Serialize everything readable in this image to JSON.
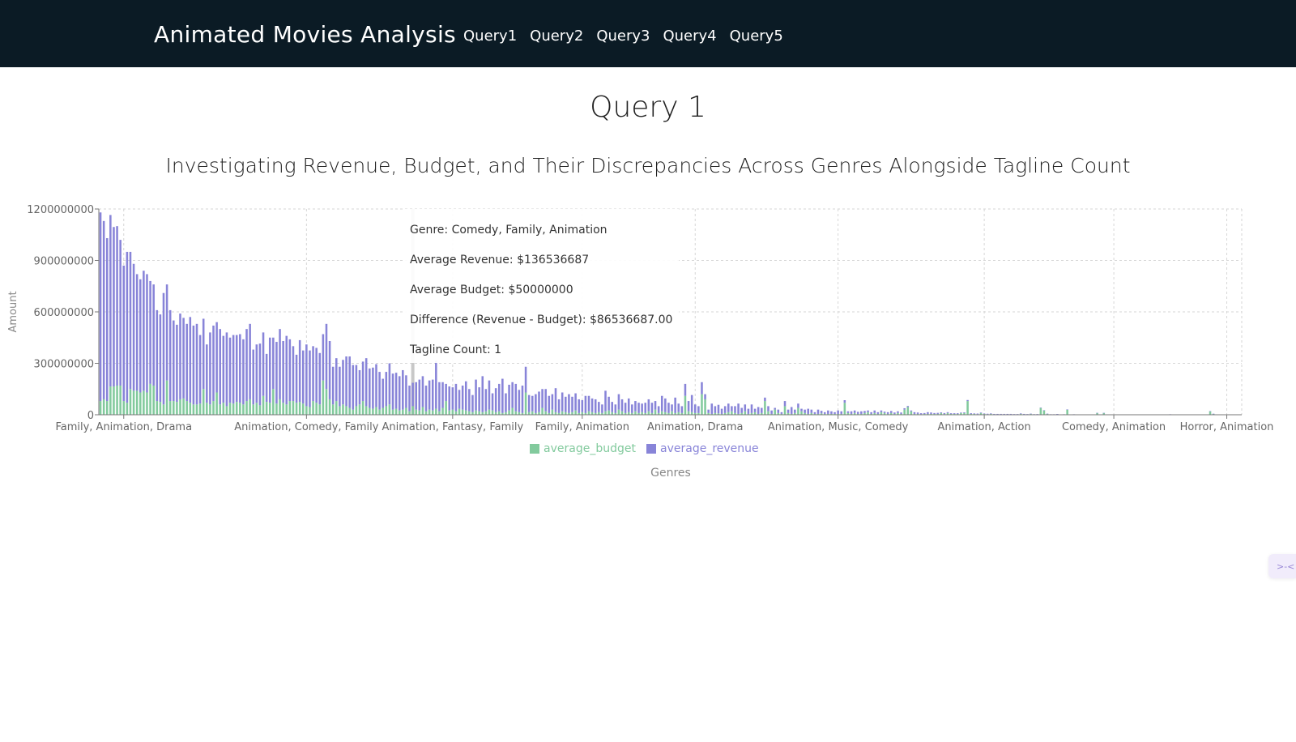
{
  "navbar": {
    "brand": "Animated Movies Analysis",
    "links": [
      "Query1",
      "Query2",
      "Query3",
      "Query4",
      "Query5"
    ]
  },
  "page": {
    "heading": "Query 1"
  },
  "tooltip": {
    "genre": "Genre: Comedy, Family, Animation",
    "revenue": "Average Revenue: $136536687",
    "budget": "Average Budget: $50000000",
    "difference": "Difference (Revenue - Budget): $86536687.00",
    "tagline": "Tagline Count: 1"
  },
  "chart_data": {
    "type": "bar",
    "title": "Investigating Revenue, Budget, and Their Discrepancies Across Genres Alongside Tagline Count",
    "xlabel": "Genres",
    "ylabel": "Amount",
    "ylim": [
      0,
      1200000000
    ],
    "yticks": [
      0,
      300000000,
      600000000,
      900000000,
      1200000000
    ],
    "grid": true,
    "legend_position": "bottom",
    "colors": {
      "average_budget": "#82ca9d",
      "average_revenue": "#8884d8"
    },
    "tick_categories": [
      "Family, Animation, Drama",
      "Animation, Comedy, Family",
      "Animation, Fantasy, Family",
      "Family, Animation",
      "Animation, Drama",
      "Animation, Music, Comedy",
      "Animation, Action",
      "Comedy, Animation",
      "Horror, Animation"
    ],
    "tick_indices": [
      7,
      62,
      106,
      145,
      179,
      222,
      266,
      305,
      339
    ],
    "highlight_index": 94,
    "series": [
      {
        "name": "average_budget",
        "values": [
          80000000,
          90000000,
          80000000,
          165000000,
          165000000,
          170000000,
          170000000,
          80000000,
          70000000,
          150000000,
          140000000,
          140000000,
          130000000,
          140000000,
          130000000,
          180000000,
          170000000,
          80000000,
          75000000,
          60000000,
          200000000,
          80000000,
          80000000,
          75000000,
          90000000,
          95000000,
          80000000,
          70000000,
          60000000,
          60000000,
          65000000,
          150000000,
          70000000,
          60000000,
          80000000,
          130000000,
          60000000,
          70000000,
          50000000,
          70000000,
          65000000,
          75000000,
          70000000,
          60000000,
          80000000,
          90000000,
          60000000,
          70000000,
          55000000,
          110000000,
          75000000,
          70000000,
          150000000,
          65000000,
          90000000,
          70000000,
          60000000,
          80000000,
          80000000,
          70000000,
          75000000,
          65000000,
          50000000,
          45000000,
          80000000,
          70000000,
          60000000,
          200000000,
          150000000,
          90000000,
          60000000,
          80000000,
          50000000,
          60000000,
          50000000,
          40000000,
          30000000,
          50000000,
          60000000,
          80000000,
          50000000,
          40000000,
          35000000,
          45000000,
          30000000,
          40000000,
          50000000,
          60000000,
          30000000,
          35000000,
          25000000,
          30000000,
          40000000,
          20000000,
          50000000,
          30000000,
          25000000,
          45000000,
          20000000,
          30000000,
          25000000,
          35000000,
          20000000,
          40000000,
          80000000,
          25000000,
          30000000,
          20000000,
          35000000,
          30000000,
          25000000,
          20000000,
          15000000,
          25000000,
          20000000,
          15000000,
          20000000,
          30000000,
          25000000,
          15000000,
          20000000,
          10000000,
          15000000,
          25000000,
          40000000,
          20000000,
          15000000,
          10000000,
          130000000,
          15000000,
          20000000,
          10000000,
          15000000,
          40000000,
          20000000,
          10000000,
          30000000,
          15000000,
          10000000,
          20000000,
          15000000,
          10000000,
          15000000,
          25000000,
          10000000,
          15000000,
          10000000,
          20000000,
          15000000,
          10000000,
          15000000,
          10000000,
          20000000,
          25000000,
          15000000,
          10000000,
          30000000,
          20000000,
          10000000,
          15000000,
          10000000,
          20000000,
          10000000,
          15000000,
          10000000,
          20000000,
          10000000,
          30000000,
          10000000,
          20000000,
          15000000,
          10000000,
          20000000,
          10000000,
          15000000,
          10000000,
          110000000,
          20000000,
          15000000,
          10000000,
          10000000,
          120000000,
          90000000,
          10000000,
          5000000,
          10000000,
          8000000,
          5000000,
          10000000,
          15000000,
          20000000,
          10000000,
          5000000,
          10000000,
          20000000,
          5000000,
          10000000,
          15000000,
          5000000,
          10000000,
          80000000,
          20000000,
          5000000,
          30000000,
          10000000,
          5000000,
          50000000,
          10000000,
          5000000,
          10000000,
          40000000,
          20000000,
          10000000,
          5000000,
          10000000,
          5000000,
          5000000,
          8000000,
          5000000,
          5000000,
          5000000,
          5000000,
          5000000,
          5000000,
          70000000,
          10000000,
          5000000,
          10000000,
          5000000,
          5000000,
          10000000,
          15000000,
          5000000,
          10000000,
          5000000,
          15000000,
          10000000,
          5000000,
          10000000,
          5000000,
          10000000,
          5000000,
          30000000,
          45000000,
          20000000,
          5000000,
          5000000,
          3000000,
          5000000,
          5000000,
          5000000,
          5000000,
          5000000,
          10000000,
          5000000,
          10000000,
          5000000,
          5000000,
          5000000,
          10000000,
          10000000,
          80000000,
          5000000,
          5000000,
          3000000,
          10000000,
          5000000,
          3000000,
          5000000,
          3000000,
          2000000,
          3000000,
          3000000,
          2000000,
          3000000,
          2000000,
          2000000,
          5000000,
          3000000,
          2000000,
          5000000,
          2000000,
          2000000,
          40000000,
          25000000,
          5000000,
          2000000,
          2000000,
          3000000,
          1000000,
          2000000,
          30000000,
          1000000,
          2000000,
          1000000,
          1000000,
          1000000,
          1000000,
          1000000,
          1000000,
          10000000,
          1000000,
          10000000,
          1000000,
          1000000,
          1000000,
          1000000,
          1000000,
          1000000,
          1000000,
          1000000,
          1000000,
          1000000,
          1000000,
          1000000,
          1000000,
          1000000,
          1000000,
          1000000,
          1000000,
          1000000,
          1000000,
          2000000,
          1000000,
          1000000,
          1000000,
          1000000,
          1000000,
          1000000,
          1000000,
          1000000,
          1000000,
          1000000,
          1000000,
          20000000,
          5000000,
          1000000,
          1000000,
          1000000,
          1000000,
          1000000,
          1000000,
          1000000,
          1000000,
          1000000,
          1000000
        ]
      },
      {
        "name": "average_revenue",
        "values": [
          1100000000,
          1040000000,
          950000000,
          1000000000,
          930000000,
          930000000,
          850000000,
          790000000,
          880000000,
          800000000,
          740000000,
          680000000,
          660000000,
          700000000,
          690000000,
          600000000,
          590000000,
          530000000,
          510000000,
          650000000,
          560000000,
          530000000,
          470000000,
          450000000,
          500000000,
          470000000,
          450000000,
          500000000,
          460000000,
          470000000,
          400000000,
          410000000,
          340000000,
          420000000,
          440000000,
          410000000,
          440000000,
          390000000,
          430000000,
          380000000,
          400000000,
          390000000,
          400000000,
          380000000,
          420000000,
          440000000,
          320000000,
          340000000,
          360000000,
          370000000,
          280000000,
          380000000,
          300000000,
          360000000,
          410000000,
          360000000,
          400000000,
          360000000,
          320000000,
          280000000,
          360000000,
          310000000,
          360000000,
          330000000,
          320000000,
          320000000,
          300000000,
          270000000,
          380000000,
          340000000,
          220000000,
          250000000,
          230000000,
          260000000,
          290000000,
          300000000,
          260000000,
          240000000,
          200000000,
          230000000,
          280000000,
          230000000,
          240000000,
          250000000,
          220000000,
          170000000,
          200000000,
          240000000,
          210000000,
          210000000,
          200000000,
          230000000,
          190000000,
          150000000,
          136536687,
          160000000,
          180000000,
          180000000,
          150000000,
          170000000,
          180000000,
          280000000,
          170000000,
          150000000,
          100000000,
          140000000,
          130000000,
          160000000,
          110000000,
          140000000,
          170000000,
          130000000,
          100000000,
          180000000,
          140000000,
          210000000,
          130000000,
          170000000,
          100000000,
          140000000,
          160000000,
          200000000,
          110000000,
          150000000,
          150000000,
          160000000,
          130000000,
          160000000,
          150000000,
          100000000,
          90000000,
          110000000,
          120000000,
          110000000,
          130000000,
          100000000,
          90000000,
          140000000,
          80000000,
          110000000,
          90000000,
          110000000,
          90000000,
          100000000,
          80000000,
          70000000,
          100000000,
          90000000,
          80000000,
          80000000,
          60000000,
          50000000,
          120000000,
          80000000,
          60000000,
          50000000,
          90000000,
          70000000,
          60000000,
          80000000,
          50000000,
          60000000,
          60000000,
          50000000,
          60000000,
          70000000,
          60000000,
          50000000,
          40000000,
          90000000,
          80000000,
          60000000,
          40000000,
          90000000,
          50000000,
          40000000,
          70000000,
          60000000,
          100000000,
          50000000,
          40000000,
          70000000,
          30000000,
          20000000,
          60000000,
          40000000,
          50000000,
          30000000,
          40000000,
          50000000,
          30000000,
          40000000,
          60000000,
          30000000,
          40000000,
          30000000,
          50000000,
          20000000,
          40000000,
          30000000,
          20000000,
          30000000,
          20000000,
          10000000,
          20000000,
          10000000,
          30000000,
          20000000,
          40000000,
          20000000,
          25000000,
          15000000,
          20000000,
          30000000,
          20000000,
          10000000,
          25000000,
          15000000,
          10000000,
          20000000,
          15000000,
          10000000,
          20000000,
          15000000,
          15000000,
          10000000,
          15000000,
          15000000,
          12000000,
          15000000,
          12000000,
          10000000,
          10000000,
          15000000,
          10000000,
          10000000,
          8000000,
          10000000,
          12000000,
          8000000,
          10000000,
          8000000,
          8000000,
          6000000,
          5000000,
          10000000,
          8000000,
          6000000,
          5000000,
          10000000,
          8000000,
          5000000,
          6000000,
          4000000,
          5000000,
          5000000,
          4000000,
          4000000,
          4000000,
          3000000,
          4000000,
          6000000,
          4000000,
          3000000,
          4000000,
          3000000,
          2000000,
          3000000,
          3000000,
          2000000,
          3000000,
          2000000,
          2000000,
          3000000,
          2000000,
          2000000,
          2000000,
          3000000,
          2000000,
          2000000,
          1500000,
          1500000,
          2000000,
          1500000,
          1500000,
          1500000,
          1000000,
          1000000,
          1500000,
          1000000,
          1000000,
          1000000,
          1000000,
          1000000,
          1000000,
          1000000,
          1000000,
          1000000,
          1000000,
          1000000,
          1000000,
          1000000,
          1000000,
          1000000,
          1000000,
          1000000,
          1000000,
          1000000,
          1000000,
          1000000,
          1000000,
          1000000,
          1000000,
          1000000,
          1000000,
          1000000,
          1000000,
          1000000,
          1000000,
          1000000,
          1000000,
          1000000,
          1000000,
          1000000,
          1000000,
          1000000,
          1000000,
          1000000,
          1000000,
          1000000,
          1000000,
          1000000,
          1000000,
          1000000,
          1000000,
          1000000,
          1000000,
          1000000,
          1000000,
          1000000,
          1000000,
          1000000,
          1000000,
          1000000
        ]
      }
    ]
  }
}
